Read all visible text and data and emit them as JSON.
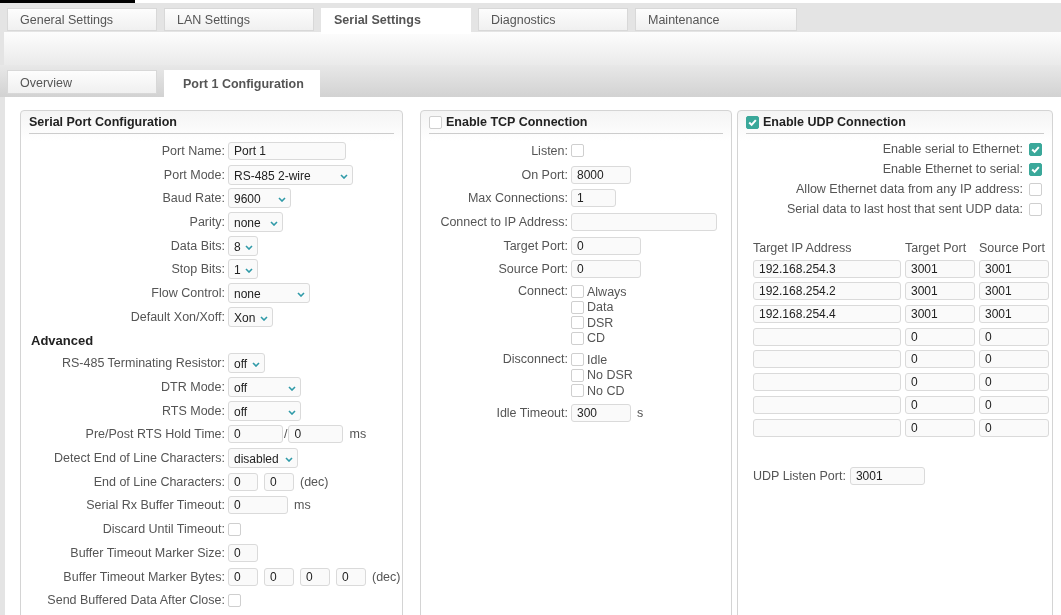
{
  "tabs": [
    {
      "label": "General Settings",
      "selected": false
    },
    {
      "label": "LAN Settings",
      "selected": false
    },
    {
      "label": "Serial Settings",
      "selected": true
    },
    {
      "label": "Diagnostics",
      "selected": false
    },
    {
      "label": "Maintenance",
      "selected": false
    }
  ],
  "subtabs": [
    {
      "label": "Overview",
      "selected": false
    },
    {
      "label": "Port 1 Configuration",
      "selected": true
    }
  ],
  "serial_panel": {
    "title": "Serial Port Configuration",
    "rows": [
      {
        "kind": "text",
        "label": "Port Name:",
        "values": [
          "Port 1"
        ]
      },
      {
        "kind": "select",
        "label": "Port Mode:",
        "value": "RS-485 2-wire"
      },
      {
        "kind": "select",
        "label": "Baud Rate:",
        "value": "9600"
      },
      {
        "kind": "select",
        "label": "Parity:",
        "value": "none"
      },
      {
        "kind": "select",
        "label": "Data Bits:",
        "value": "8"
      },
      {
        "kind": "select",
        "label": "Stop Bits:",
        "value": "1"
      },
      {
        "kind": "select",
        "label": "Flow Control:",
        "value": "none"
      },
      {
        "kind": "select",
        "label": "Default Xon/Xoff:",
        "value": "Xon"
      },
      {
        "kind": "heading",
        "label": "Advanced"
      },
      {
        "kind": "select",
        "label": "RS-485 Terminating Resistor:",
        "value": "off"
      },
      {
        "kind": "select",
        "label": "DTR Mode:",
        "value": "off"
      },
      {
        "kind": "select",
        "label": "RTS Mode:",
        "value": "off"
      },
      {
        "kind": "text",
        "label": "Pre/Post RTS Hold Time:",
        "values": [
          "0",
          "0"
        ],
        "separator": "/",
        "unit": "ms"
      },
      {
        "kind": "select",
        "label": "Detect End of Line Characters:",
        "value": "disabled"
      },
      {
        "kind": "text",
        "label": "End of Line Characters:",
        "values": [
          "0",
          "0"
        ],
        "unit": "(dec)"
      },
      {
        "kind": "text",
        "label": "Serial Rx Buffer Timeout:",
        "values": [
          "0"
        ],
        "unit": "ms"
      },
      {
        "kind": "checkbox",
        "label": "Discard Until Timeout:",
        "checked": false
      },
      {
        "kind": "text",
        "label": "Buffer Timeout Marker Size:",
        "values": [
          "0"
        ]
      },
      {
        "kind": "text",
        "label": "Buffer Timeout Marker Bytes:",
        "values": [
          "0",
          "0",
          "0",
          "0"
        ],
        "unit": "(dec)"
      },
      {
        "kind": "checkbox",
        "label": "Send Buffered Data After Close:",
        "checked": false
      }
    ]
  },
  "tcp_panel": {
    "title": "Enable TCP Connection",
    "checked": false,
    "rows": [
      {
        "kind": "checkbox",
        "label": "Listen:",
        "checked": false
      },
      {
        "kind": "text",
        "label": "On Port:",
        "values": [
          "8000"
        ]
      },
      {
        "kind": "text",
        "label": "Max Connections:",
        "values": [
          "1"
        ]
      },
      {
        "kind": "text",
        "label": "Connect to IP Address:"
      },
      {
        "kind": "text",
        "label": "Target Port:",
        "values": [
          "0"
        ]
      },
      {
        "kind": "text",
        "label": "Source Port:",
        "values": [
          "0"
        ]
      },
      {
        "kind": "checklist",
        "label": "Connect:",
        "options": [
          {
            "label": "Always",
            "checked": false
          },
          {
            "label": "Data",
            "checked": false
          },
          {
            "label": "DSR",
            "checked": false
          },
          {
            "label": "CD",
            "checked": false
          }
        ]
      },
      {
        "kind": "checklist",
        "label": "Disconnect:",
        "options": [
          {
            "label": "Idle",
            "checked": false
          },
          {
            "label": "No DSR",
            "checked": false
          },
          {
            "label": "No CD",
            "checked": false
          }
        ]
      },
      {
        "kind": "text",
        "label": "Idle Timeout:",
        "values": [
          "300"
        ],
        "unit": "s"
      }
    ]
  },
  "udp_panel": {
    "title": "Enable UDP Connection",
    "checked": true,
    "options": [
      {
        "label": "Enable serial to Ethernet:",
        "checked": true
      },
      {
        "label": "Enable Ethernet to serial:",
        "checked": true
      },
      {
        "label": "Allow Ethernet data from any IP address:",
        "checked": false
      },
      {
        "label": "Serial data to last host that sent UDP data:",
        "checked": false
      }
    ],
    "columns": [
      "Target IP Address",
      "Target Port",
      "Source Port"
    ],
    "rows": [
      {
        "ip": "192.168.254.3",
        "target_port": "3001",
        "source_port": "3001"
      },
      {
        "ip": "192.168.254.2",
        "target_port": "3001",
        "source_port": "3001"
      },
      {
        "ip": "192.168.254.4",
        "target_port": "3001",
        "source_port": "3001"
      },
      {
        "target_port": "0",
        "source_port": "0"
      },
      {
        "target_port": "0",
        "source_port": "0"
      },
      {
        "target_port": "0",
        "source_port": "0"
      },
      {
        "target_port": "0",
        "source_port": "0"
      },
      {
        "target_port": "0",
        "source_port": "0"
      }
    ],
    "listen_port": {
      "label": "UDP Listen Port:",
      "value": "3001"
    }
  }
}
